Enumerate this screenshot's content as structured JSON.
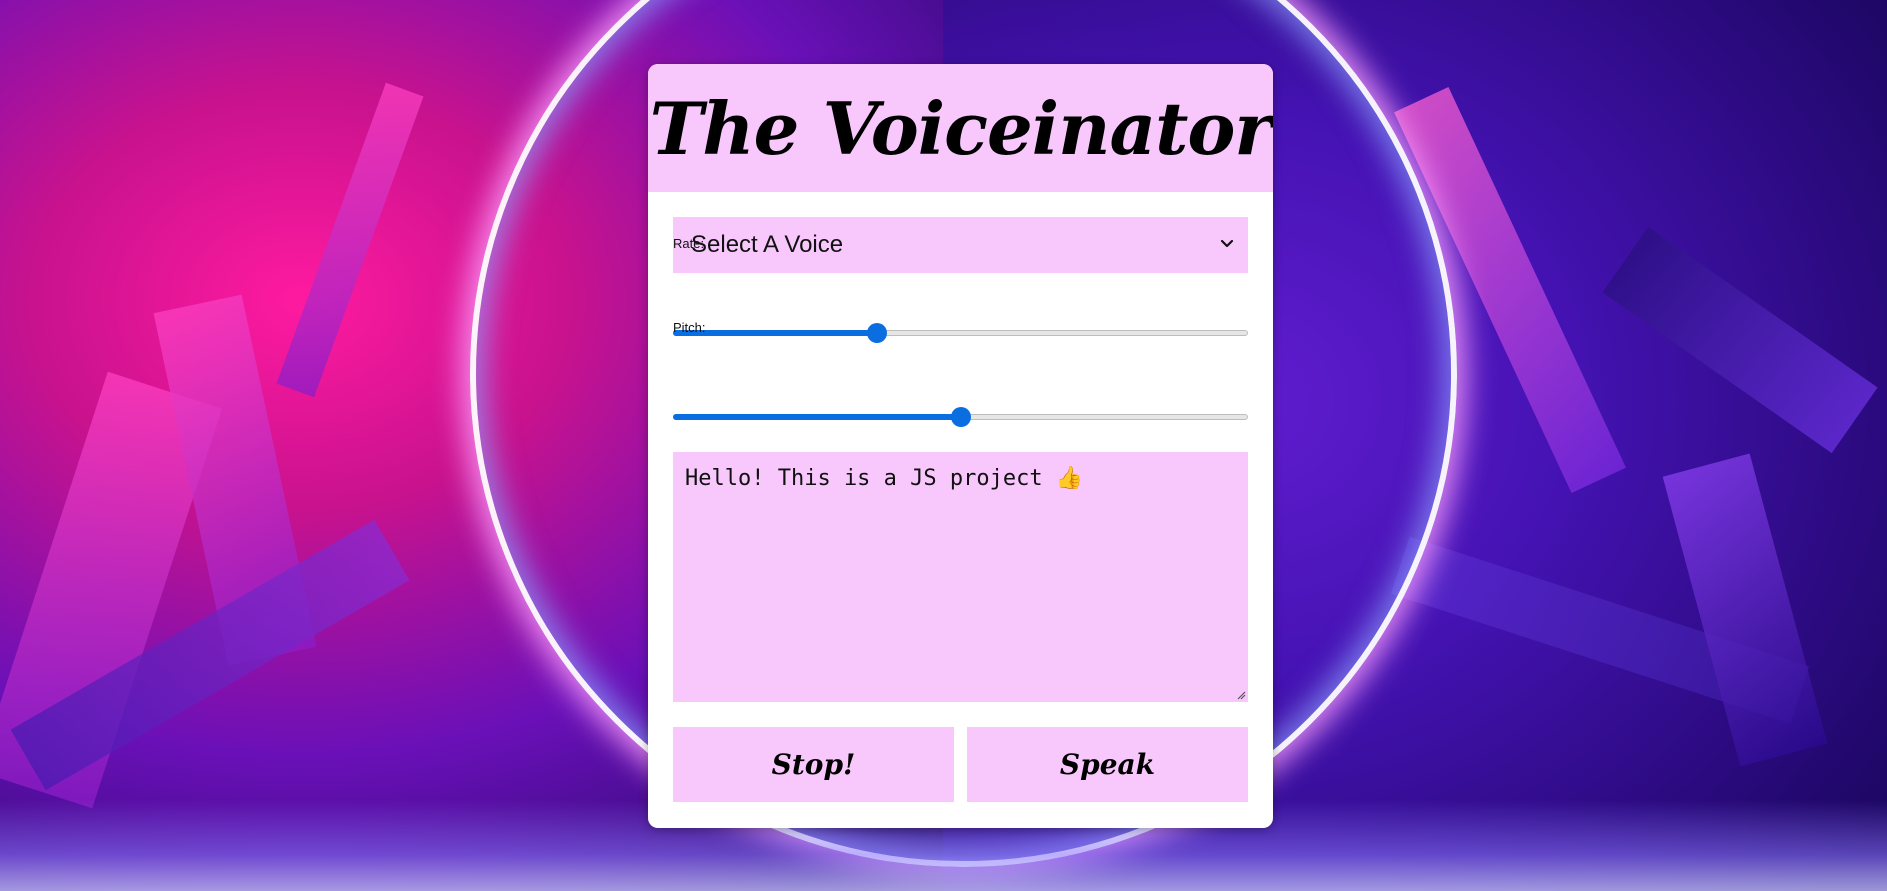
{
  "app": {
    "title": "The Voiceinator"
  },
  "voice_select": {
    "selected": "Select A Voice",
    "icon": "chevron-down-icon"
  },
  "rate": {
    "label": "Rate:",
    "value_fraction": 0.35
  },
  "pitch": {
    "label": "Pitch:",
    "value_fraction": 0.5
  },
  "message": {
    "text": "Hello! This is a JS project 👍"
  },
  "buttons": {
    "stop_label": "Stop!",
    "speak_label": "Speak"
  },
  "colors": {
    "panel_pink": "#f8c8fc",
    "slider_blue": "#0a6ee0"
  }
}
